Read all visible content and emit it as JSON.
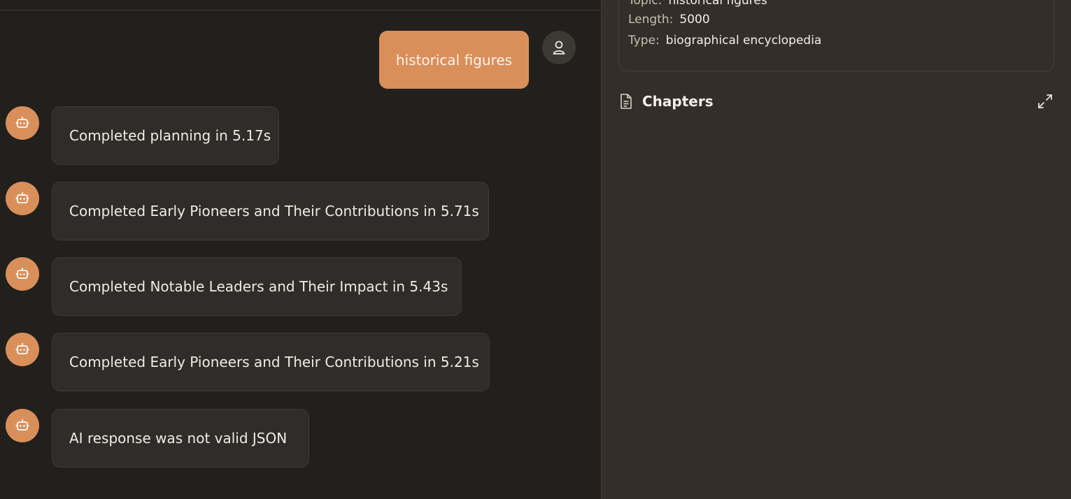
{
  "chat": {
    "user_message": "historical figures",
    "bot_messages": [
      "Completed planning in 5.17s",
      "Completed Early Pioneers and Their Contributions in 5.71s",
      "Completed Notable Leaders and Their Impact in 5.43s",
      "Completed Early Pioneers and Their Contributions in 5.21s",
      "AI response was not valid JSON"
    ]
  },
  "info": {
    "topic_label": "Topic:",
    "topic_value": "historical figures",
    "length_label": "Length:",
    "length_value": "5000",
    "type_label": "Type:",
    "type_value": "biographical encyclopedia"
  },
  "chapters": {
    "title": "Chapters"
  },
  "icons": {
    "user": "user-icon",
    "bot": "bot-icon",
    "document": "document-icon",
    "expand": "expand-icon"
  },
  "colors": {
    "accent": "#d98f5a",
    "chat_background": "#22201d",
    "panel_background": "#332e29",
    "bubble_background": "#2f2c29"
  }
}
